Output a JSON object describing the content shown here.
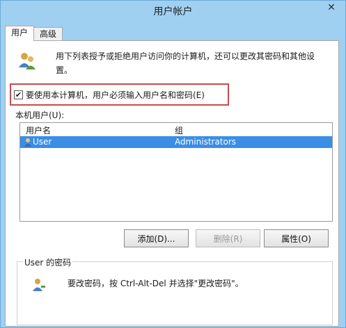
{
  "window": {
    "title": "用户帐户"
  },
  "tabs": [
    {
      "label": "用户",
      "active": true
    },
    {
      "label": "高级",
      "active": false
    }
  ],
  "intro": {
    "text": "用下列表授予或拒绝用户访问你的计算机，还可以更改其密码和其他设置。",
    "icon": "users-icon"
  },
  "require_login": {
    "label": "要使用本计算机，用户必须输入用户名和密码(E)",
    "checked": true
  },
  "users_list": {
    "label": "本机用户(U):",
    "columns": [
      "用户名",
      "组"
    ],
    "rows": [
      {
        "username": "User",
        "group": "Administrators",
        "selected": true
      }
    ]
  },
  "buttons": {
    "add": "添加(D)...",
    "remove": "删除(R)",
    "properties": "属性(O)"
  },
  "password_group": {
    "title": "User 的密码",
    "text": "要改密码，按 Ctrl-Alt-Del 并选择\"更改密码\"。"
  },
  "colors": {
    "titlebar": "#9fd0f2",
    "selection": "#3a8ee6",
    "highlight_border": "#c94a4a"
  }
}
